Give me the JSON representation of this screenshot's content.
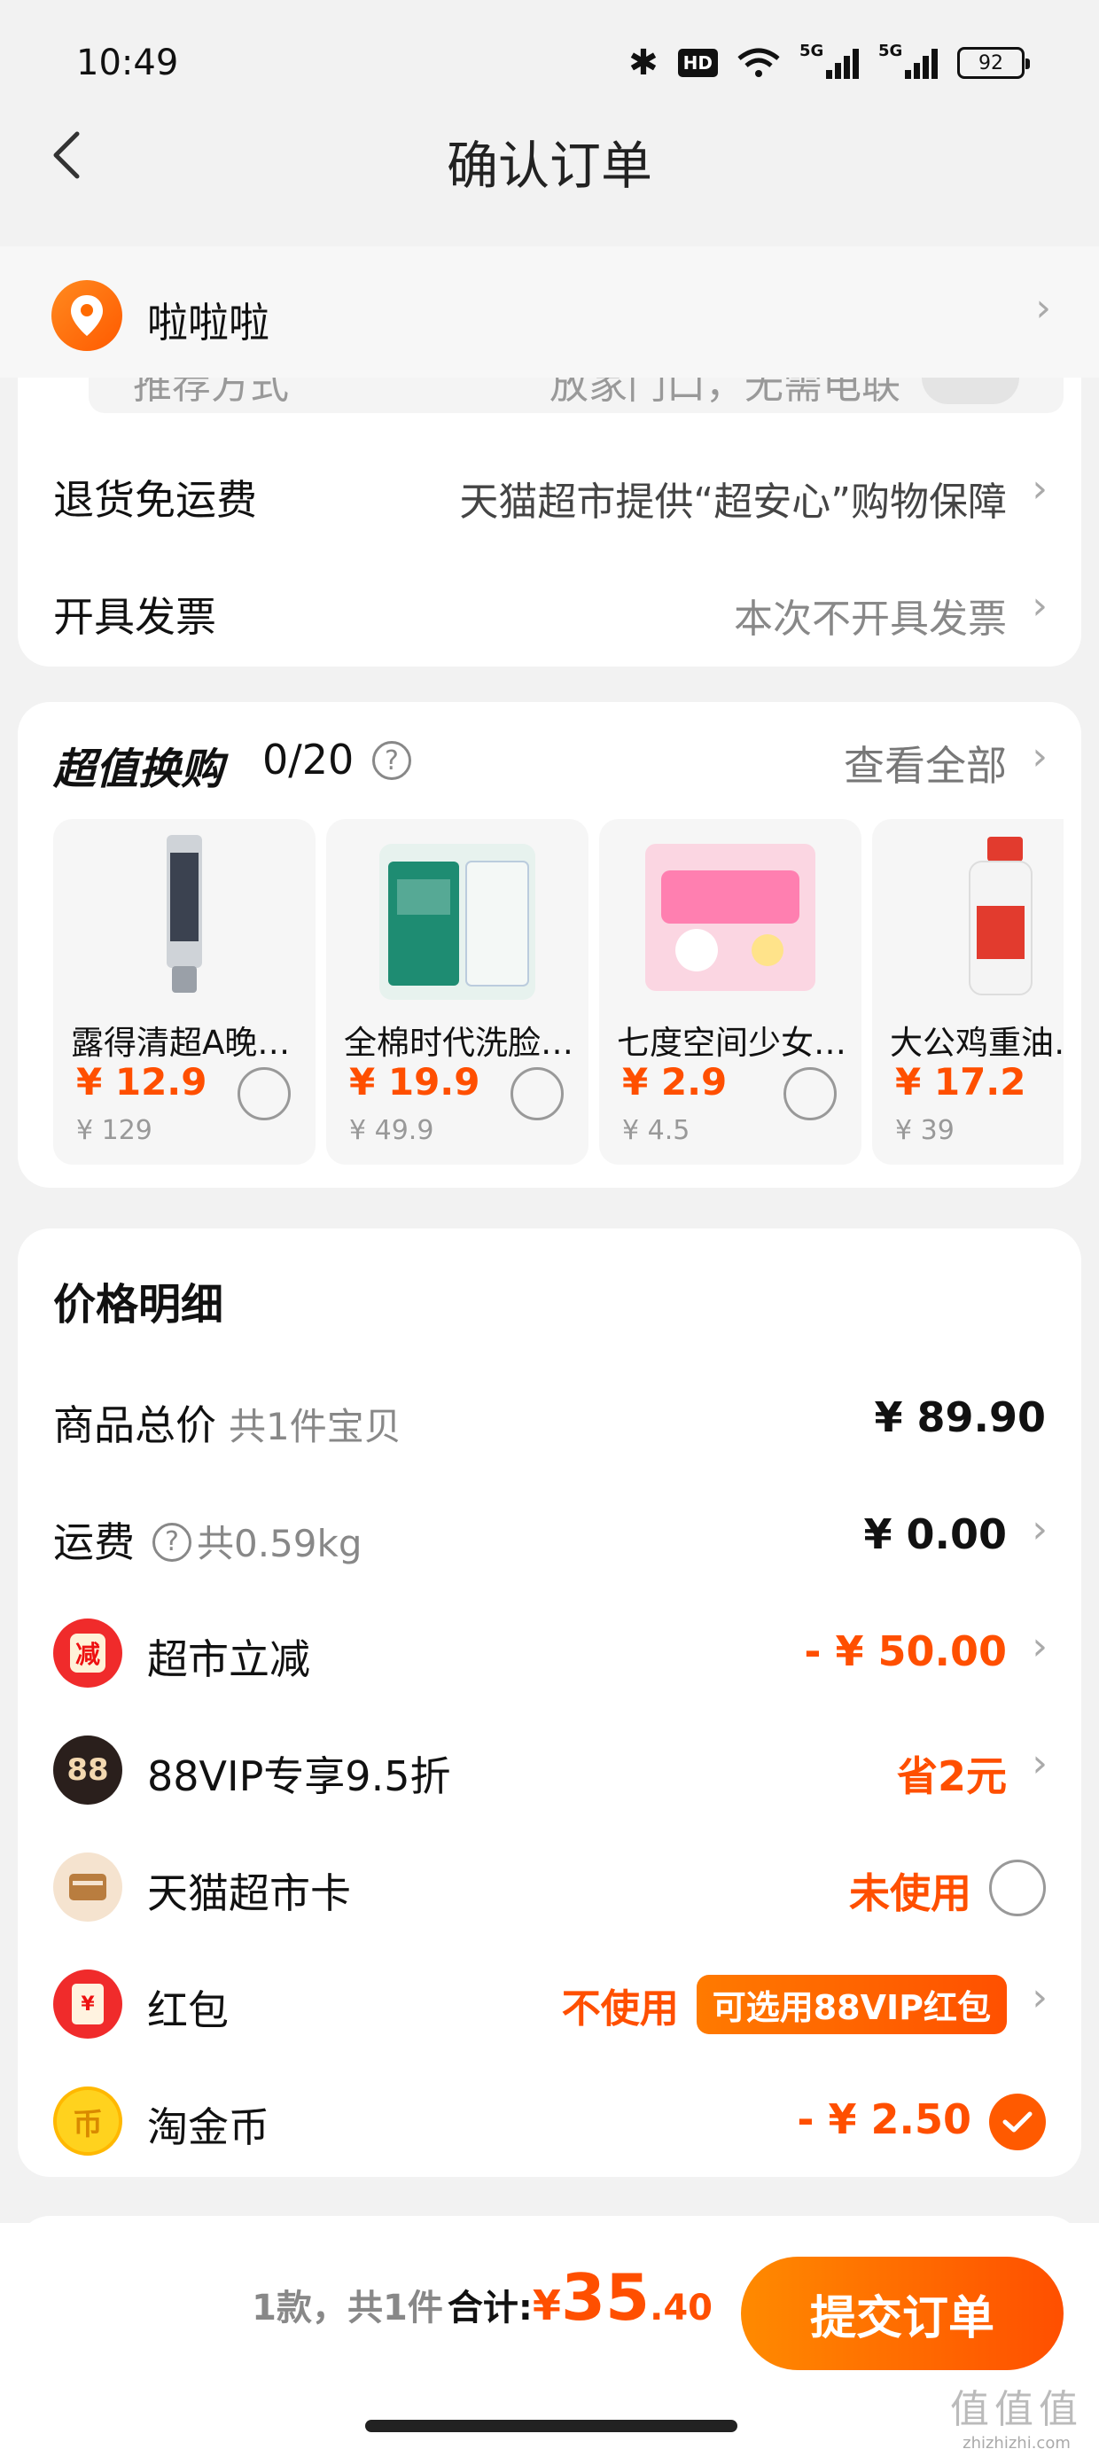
{
  "status_bar": {
    "time": "10:49",
    "hd": "HD",
    "net1": "5G",
    "net2": "5G",
    "battery": "92"
  },
  "nav": {
    "title": "确认订单"
  },
  "address": {
    "name": "啦啦啦"
  },
  "options": {
    "peek_left": "推荐方式",
    "peek_right": "放家门口，无需电联",
    "return_label": "退货免运费",
    "return_value": "天猫超市提供“超安心”购物保障",
    "invoice_label": "开具发票",
    "invoice_value": "本次不开具发票"
  },
  "swap": {
    "title": "超值换购",
    "count": "0/20",
    "see_all": "查看全部",
    "products": [
      {
        "name": "露得清超A晚…",
        "price": "¥ 12.9",
        "original": "¥ 129"
      },
      {
        "name": "全棉时代洗脸…",
        "price": "¥ 19.9",
        "original": "¥ 49.9"
      },
      {
        "name": "七度空间少女…",
        "price": "¥ 2.9",
        "original": "¥ 4.5"
      },
      {
        "name": "大公鸡重油…",
        "price": "¥ 17.2",
        "original": "¥ 39"
      }
    ]
  },
  "price_detail": {
    "title": "价格明细",
    "goods_total_label": "商品总价",
    "goods_total_sub": "共1件宝贝",
    "goods_total_value": "¥ 89.90",
    "shipping_label": "运费",
    "shipping_sub": "共0.59kg",
    "shipping_value": "¥ 0.00",
    "discount_icon": "减",
    "discount_label": "超市立减",
    "discount_value": "- ¥ 50.00",
    "vip_icon": "88",
    "vip_label": "88VIP专享9.5折",
    "vip_value": "省2元",
    "card_label": "天猫超市卡",
    "card_value": "未使用",
    "hongbao_icon": "¥",
    "hongbao_label": "红包",
    "hongbao_value": "不使用",
    "hongbao_tag": "可选用88VIP红包",
    "coin_icon": "币",
    "coin_label": "淘金币",
    "coin_value": "- ¥ 2.50"
  },
  "footer": {
    "count": "1款，共1件",
    "total_label": "合计:",
    "currency": "¥",
    "amount_int": "35",
    "amount_dec": ".40",
    "submit": "提交订单"
  },
  "watermark": {
    "glyphs": "值值值",
    "site": "zhizhizhi.com"
  },
  "colors": {
    "accent": "#ff4f00",
    "accent_gradient_start": "#ff8a00",
    "background": "#f2f2f2"
  },
  "icons": [
    "back-icon",
    "location-pin-icon",
    "chevron-right-icon",
    "help-circle-icon",
    "checkmark-icon",
    "bluetooth-icon",
    "wifi-icon",
    "signal-icon",
    "battery-icon"
  ]
}
